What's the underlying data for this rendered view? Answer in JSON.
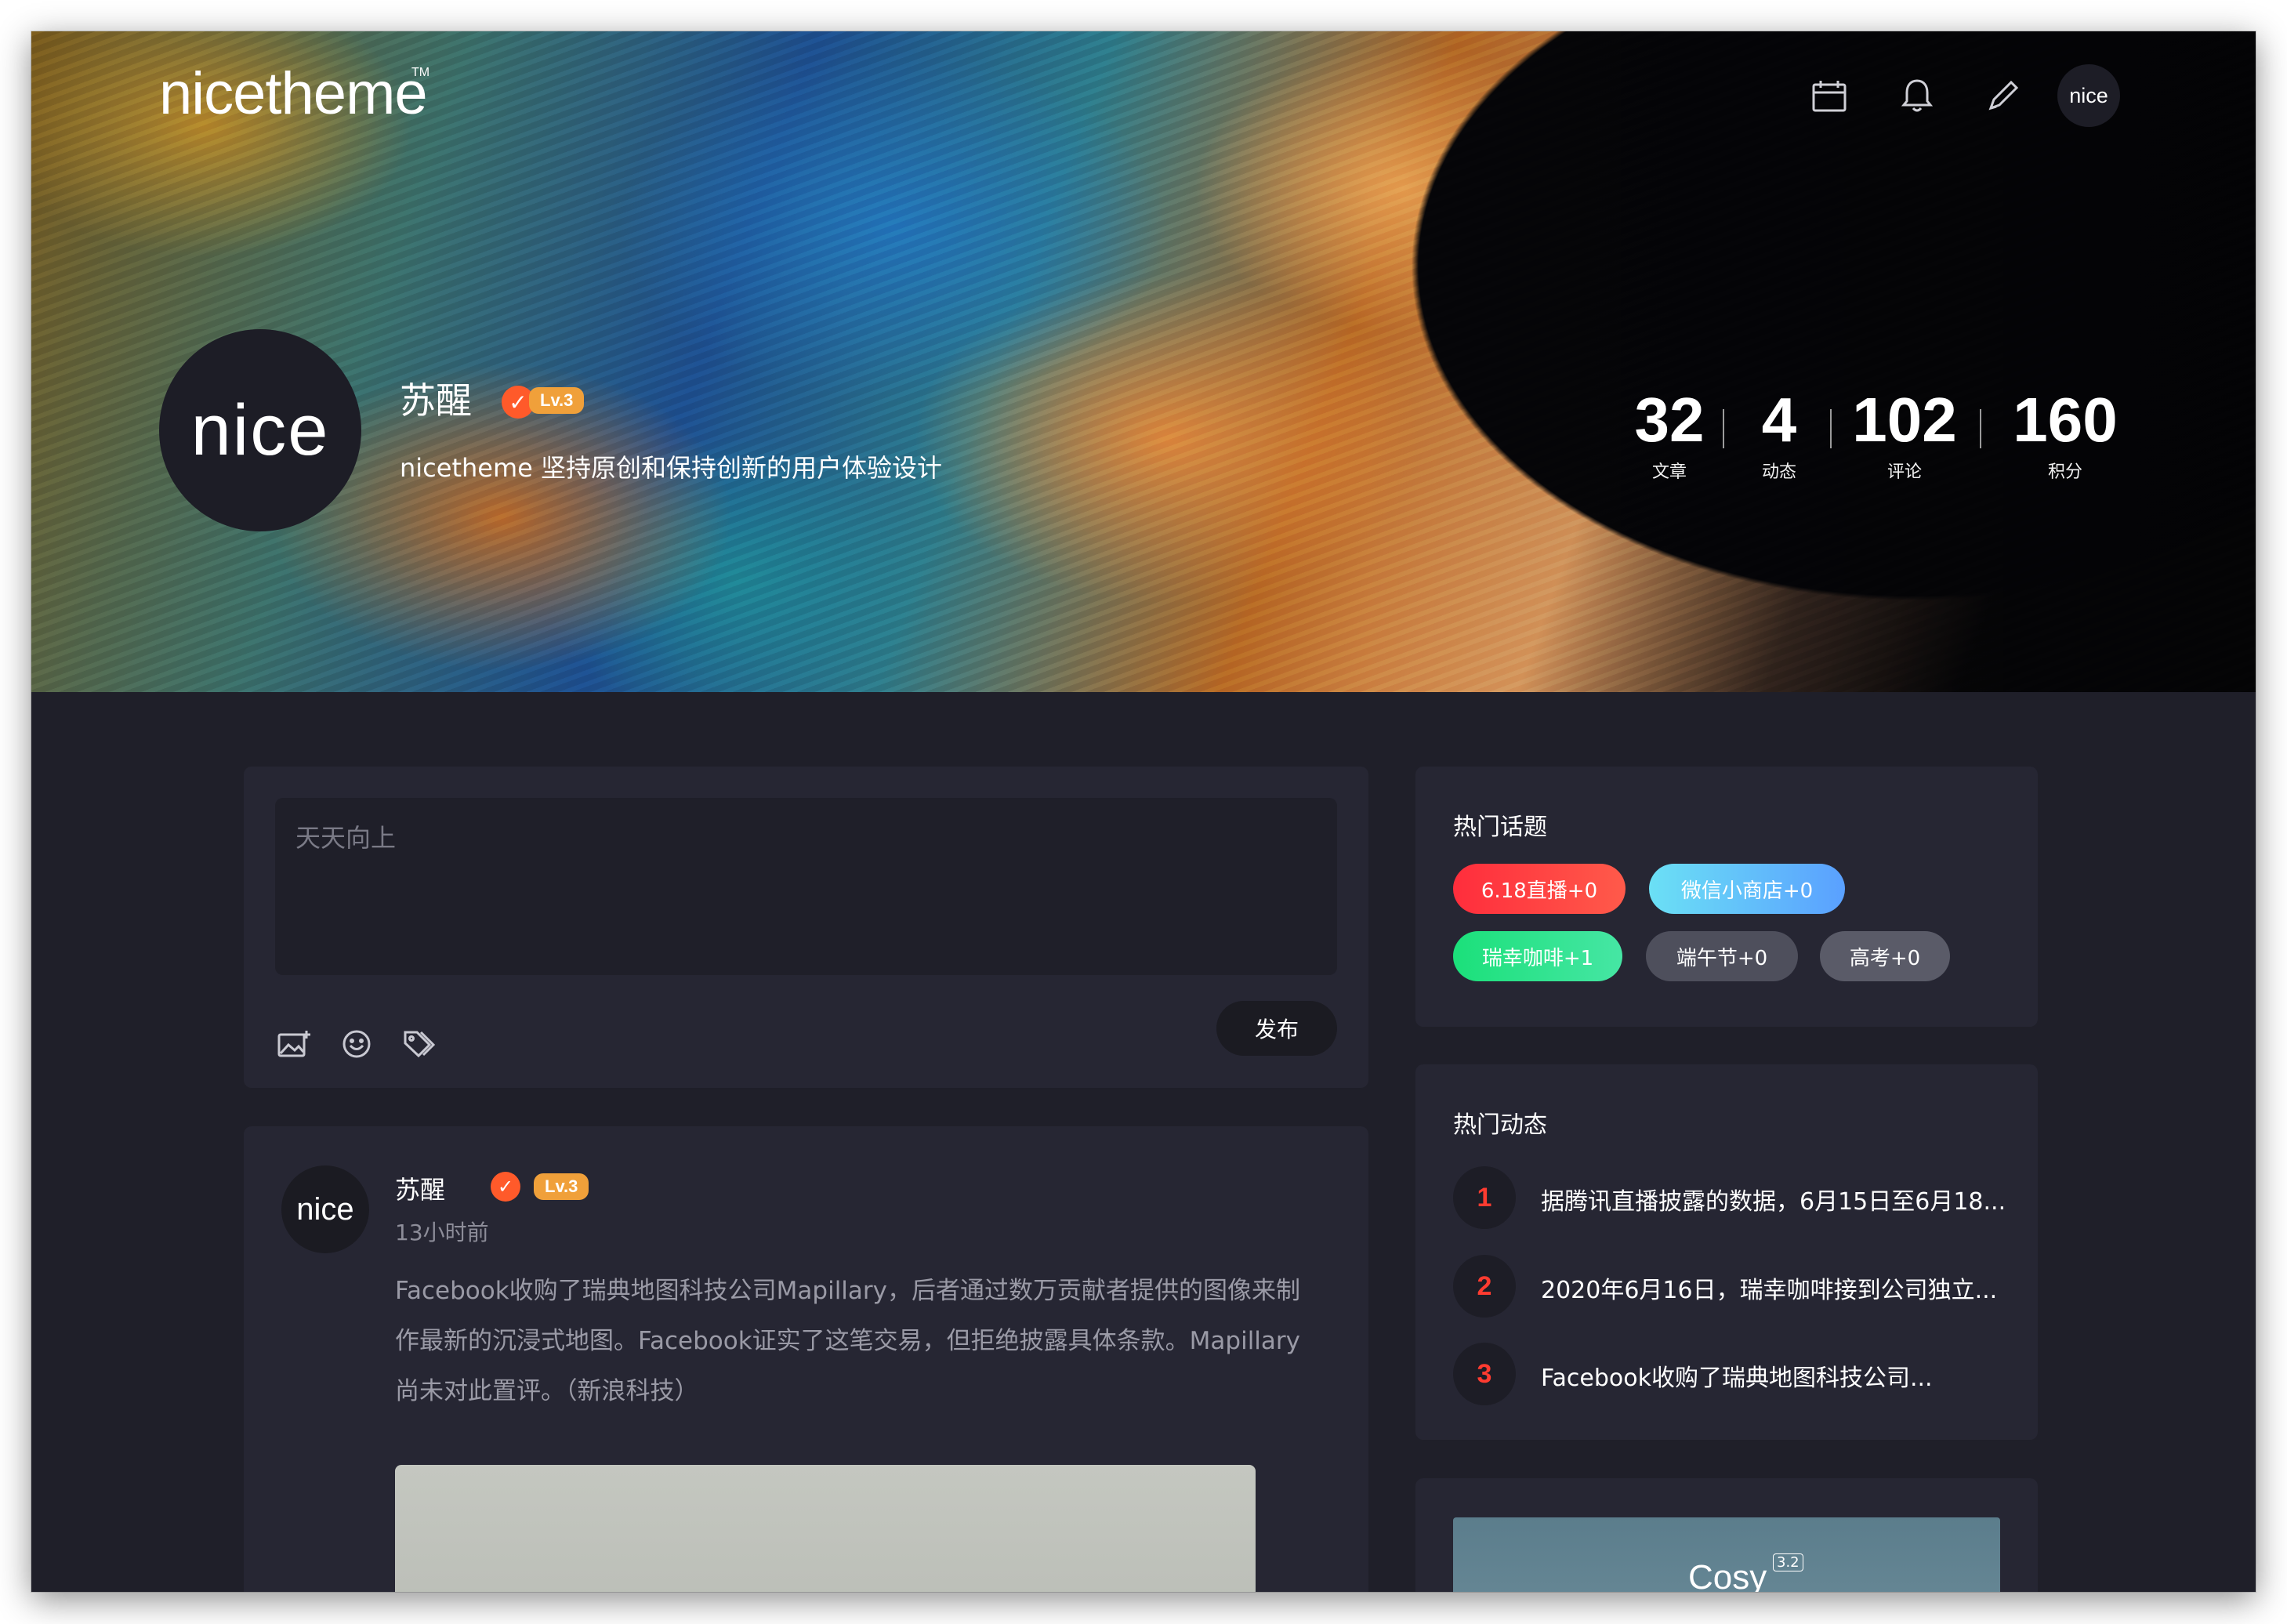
{
  "brand": {
    "logo_text": "nicetheme",
    "tm": "TM"
  },
  "header": {
    "icons": [
      "calendar-icon",
      "bell-icon",
      "pencil-icon"
    ],
    "avatar_text": "nice"
  },
  "profile": {
    "avatar_text": "nice",
    "name": "苏醒",
    "verified_icon": "check-badge-icon",
    "level": "Lv.3",
    "bio": "nicetheme 坚持原创和保持创新的用户体验设计",
    "stats": [
      {
        "value": "32",
        "label": "文章"
      },
      {
        "value": "4",
        "label": "动态"
      },
      {
        "value": "102",
        "label": "评论"
      },
      {
        "value": "160",
        "label": "积分"
      }
    ]
  },
  "composer": {
    "placeholder": "天天向上",
    "tools": [
      "image-upload-icon",
      "emoji-icon",
      "tag-icon"
    ],
    "publish_label": "发布"
  },
  "post": {
    "avatar_text": "nice",
    "author": "苏醒",
    "level": "Lv.3",
    "time": "13小时前",
    "body_lines": [
      "Facebook收购了瑞典地图科技公司Mapillary，后者通过数万贡献者提供的图像来制",
      "作最新的沉浸式地图。Facebook证实了这笔交易，但拒绝披露具体条款。Mapillary",
      "尚未对此置评。（新浪科技）"
    ]
  },
  "hot_topics": {
    "title": "热门话题",
    "tags": [
      {
        "label": "6.18直播+0"
      },
      {
        "label": "微信小商店+0"
      },
      {
        "label": "瑞幸咖啡+1"
      },
      {
        "label": "端午节+0"
      },
      {
        "label": "高考+0"
      }
    ]
  },
  "hot_feeds": {
    "title": "热门动态",
    "items": [
      {
        "rank": "1",
        "text": "据腾讯直播披露的数据，6月15日至6月18..."
      },
      {
        "rank": "2",
        "text": "2020年6月16日，瑞幸咖啡接到公司独立..."
      },
      {
        "rank": "3",
        "text": "Facebook收购了瑞典地图科技公司..."
      }
    ]
  },
  "promo": {
    "title": "Cosy",
    "version": "3.2"
  },
  "colors": {
    "page_bg": "#1f1f29",
    "card_bg": "#262633",
    "accent_red": "#ff3b30",
    "badge_orange": "#f0a03a",
    "verified_orange": "#ff5a2a"
  }
}
